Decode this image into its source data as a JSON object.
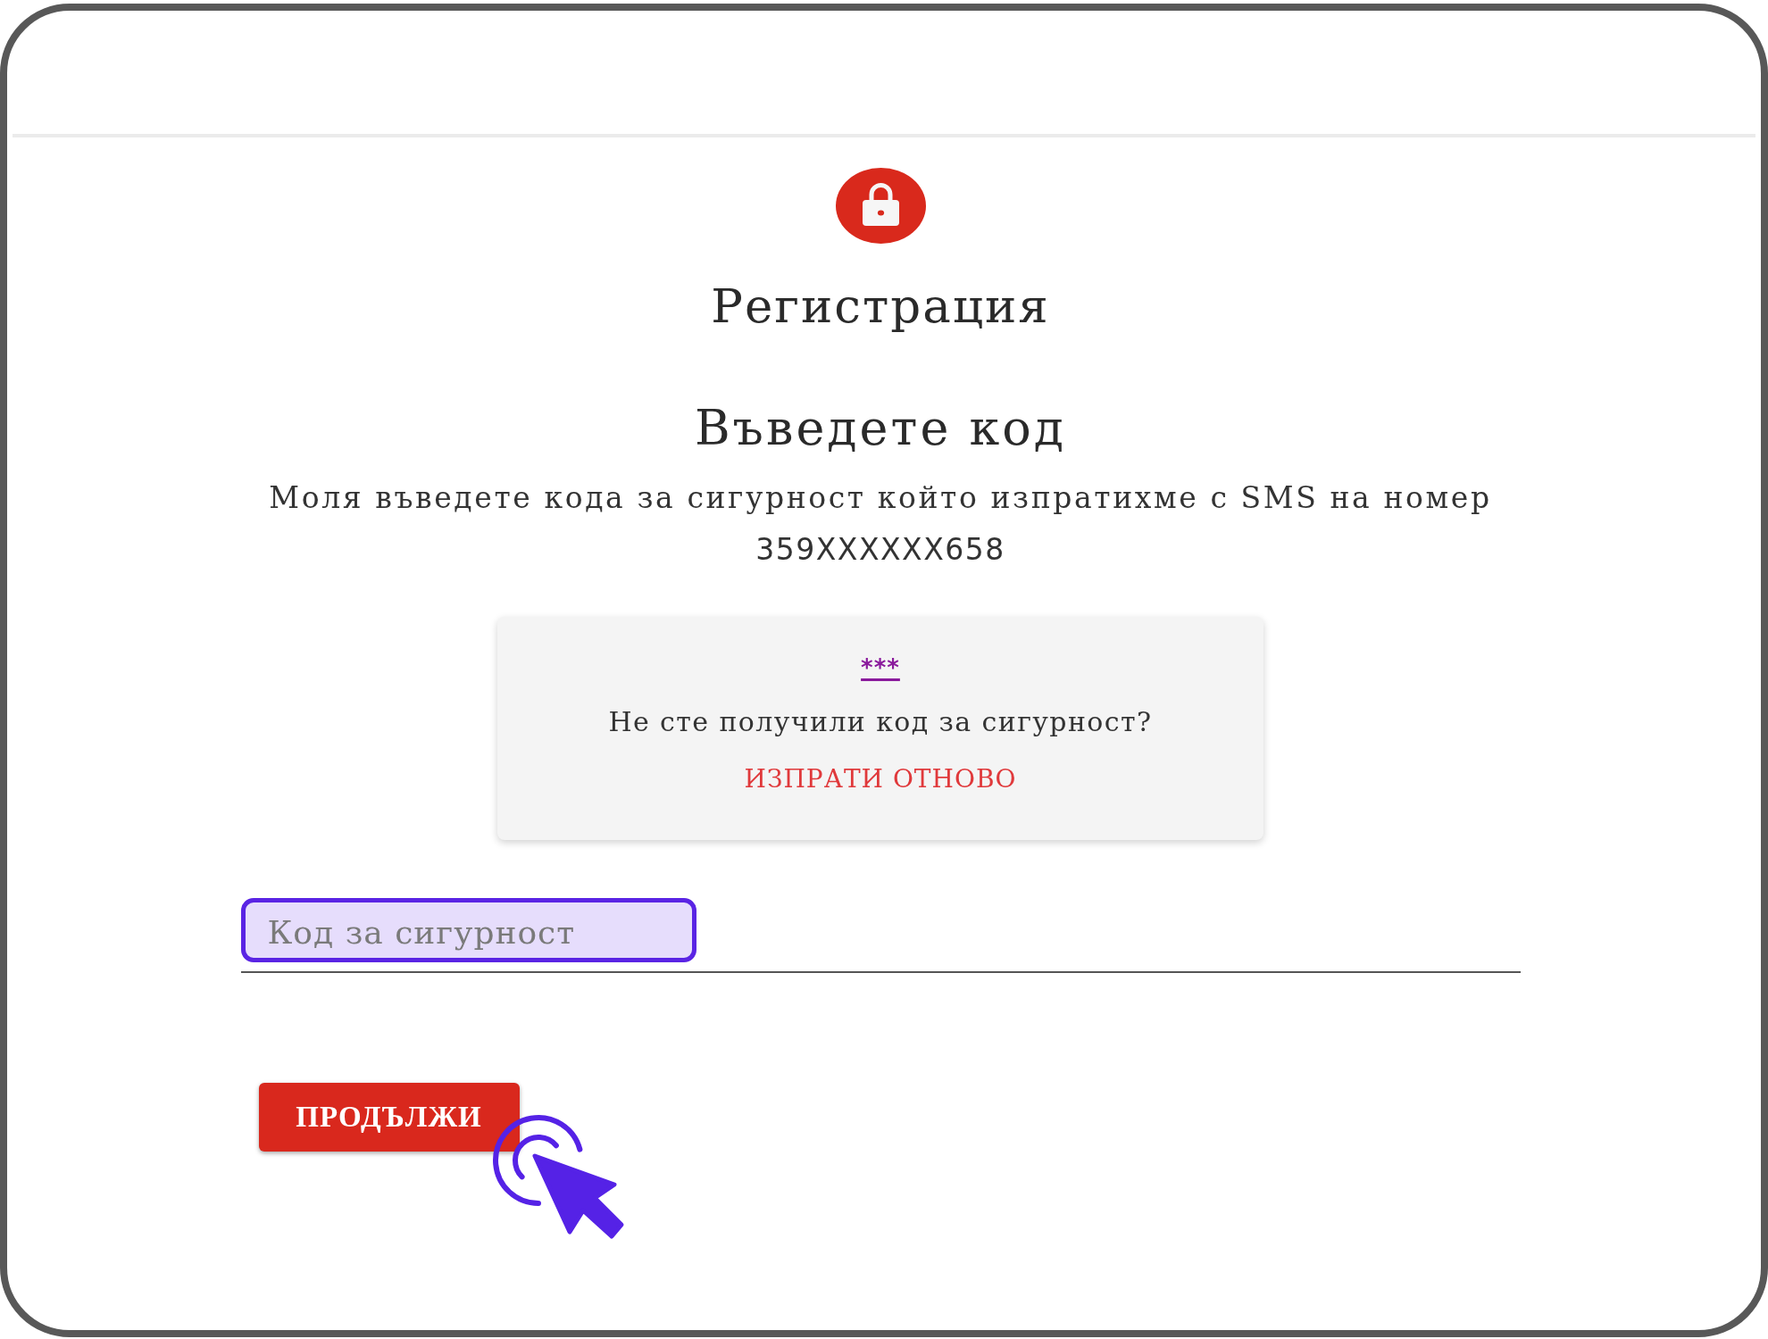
{
  "title": "Регистрация",
  "heading": "Въведете код",
  "instructions": {
    "message": "Моля въведете кода за сигурност който изпратихме с SMS на номер",
    "phone_number": "359XXXXXX658"
  },
  "resend_card": {
    "masked_code": "***",
    "question": "Не сте получили код за сигурност?",
    "resend_link": "ИЗПРАТИ ОТНОВО"
  },
  "code_field": {
    "placeholder": "Код за сигурност",
    "highlighted": true
  },
  "continue_button": {
    "label": "ПРОДЪЛЖИ"
  }
}
